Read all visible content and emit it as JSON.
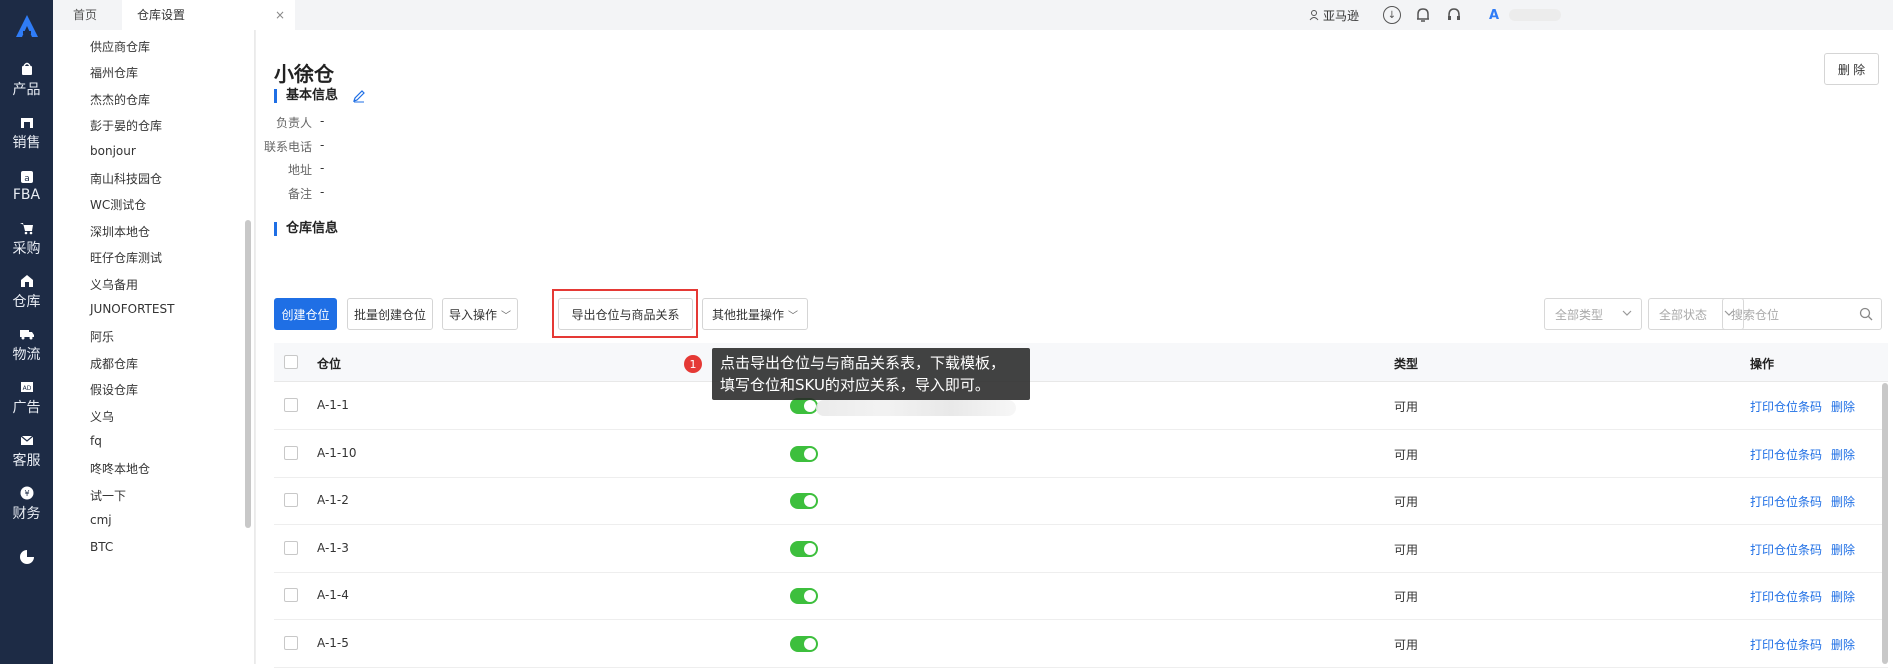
{
  "rail": {
    "items": [
      {
        "label": "产品",
        "icon": "bag-icon"
      },
      {
        "label": "销售",
        "icon": "shop-icon"
      },
      {
        "label": "FBA",
        "icon": "amazon-icon"
      },
      {
        "label": "采购",
        "icon": "cart-icon"
      },
      {
        "label": "仓库",
        "icon": "warehouse-icon"
      },
      {
        "label": "物流",
        "icon": "truck-icon"
      },
      {
        "label": "广告",
        "icon": "ad-icon"
      },
      {
        "label": "客服",
        "icon": "mail-icon"
      },
      {
        "label": "财务",
        "icon": "money-icon"
      }
    ]
  },
  "tabs": [
    {
      "label": "首页"
    },
    {
      "label": "仓库设置",
      "close": "×"
    }
  ],
  "topbar": {
    "marketplace": "亚马逊",
    "brand_letter": "A"
  },
  "warehouses": [
    "供应商仓库",
    "福州仓库",
    "杰杰的仓库",
    "彭于晏的仓库",
    "bonjour",
    "南山科技园仓",
    "WC测试仓",
    "深圳本地仓",
    "旺仔仓库测试",
    "义乌备用",
    "JUNOFORTEST",
    "阿乐",
    "成都仓库",
    "假设仓库",
    "义乌",
    "fq",
    "咚咚本地仓",
    "试一下",
    "cmj",
    "BTC"
  ],
  "detail": {
    "title": "小徐仓",
    "delete_label": "删 除",
    "basic_section": "基本信息",
    "fields": [
      {
        "key": "负责人",
        "value": "-"
      },
      {
        "key": "联系电话",
        "value": "-"
      },
      {
        "key": "地址",
        "value": "-"
      },
      {
        "key": "备注",
        "value": "-"
      }
    ],
    "warehouse_section": "仓库信息"
  },
  "toolbar": {
    "create": "创建仓位",
    "batch_create": "批量创建仓位",
    "import": "导入操作",
    "export": "导出仓位与商品关系",
    "other": "其他批量操作",
    "type_filter": "全部类型",
    "status_filter": "全部状态",
    "search_placeholder": "搜索仓位"
  },
  "table": {
    "headers": {
      "location": "仓位",
      "type": "类型",
      "action": "操作"
    },
    "rows": [
      {
        "location": "A-1-1",
        "enabled": true,
        "type": "可用"
      },
      {
        "location": "A-1-10",
        "enabled": true,
        "type": "可用"
      },
      {
        "location": "A-1-2",
        "enabled": true,
        "type": "可用"
      },
      {
        "location": "A-1-3",
        "enabled": true,
        "type": "可用"
      },
      {
        "location": "A-1-4",
        "enabled": true,
        "type": "可用"
      },
      {
        "location": "A-1-5",
        "enabled": true,
        "type": "可用"
      }
    ],
    "print_label": "打印仓位条码",
    "delete_label": "删除"
  },
  "tooltip": {
    "number": "1",
    "line1": "点击导出仓位与与商品关系表，下载模板，",
    "line2": "填写仓位和SKU的对应关系，导入即可。"
  },
  "colors": {
    "primary": "#1f6fe5",
    "rail": "#1d2b45",
    "toggle_on": "#3dbf3d",
    "highlight": "#e53935"
  }
}
